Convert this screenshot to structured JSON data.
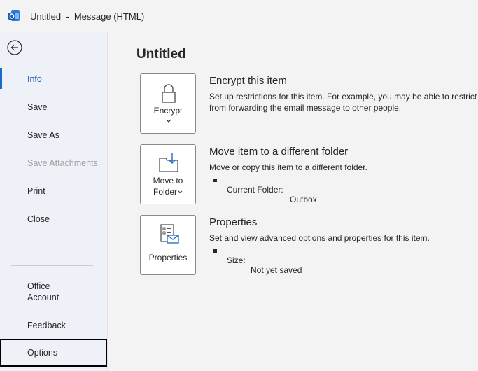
{
  "window": {
    "title": "Untitled  -  Message (HTML)",
    "accent_color": "#1b6ac9"
  },
  "sidebar": {
    "back_icon": "back-arrow-icon",
    "items": [
      {
        "label": "Info",
        "state": "active"
      },
      {
        "label": "Save",
        "state": "normal"
      },
      {
        "label": "Save As",
        "state": "normal"
      },
      {
        "label": "Save Attachments",
        "state": "disabled"
      },
      {
        "label": "Print",
        "state": "normal"
      },
      {
        "label": "Close",
        "state": "normal"
      }
    ],
    "bottom_items": [
      {
        "label": "Office Account"
      },
      {
        "label": "Feedback"
      },
      {
        "label": "Options",
        "state": "focused"
      }
    ]
  },
  "main": {
    "page_title": "Untitled",
    "sections": [
      {
        "button_label": "Encrypt",
        "button_icon": "lock-icon",
        "title": "Encrypt this item",
        "desc_line1": "Set up restrictions for this item. For example, you may be able to restrict r",
        "desc_line2": "from forwarding the email message to other people."
      },
      {
        "button_label_line1": "Move to",
        "button_label_line2": "Folder",
        "button_icon": "move-folder-icon",
        "title": "Move item to a different folder",
        "desc_line1": "Move or copy this item to a different folder.",
        "bullet_key": "Current Folder:",
        "bullet_value": "Outbox"
      },
      {
        "button_label": "Properties",
        "button_icon": "properties-icon",
        "title": "Properties",
        "desc_line1": "Set and view advanced options and properties for this item.",
        "bullet_key": "Size:",
        "bullet_value": "Not yet saved"
      }
    ]
  }
}
